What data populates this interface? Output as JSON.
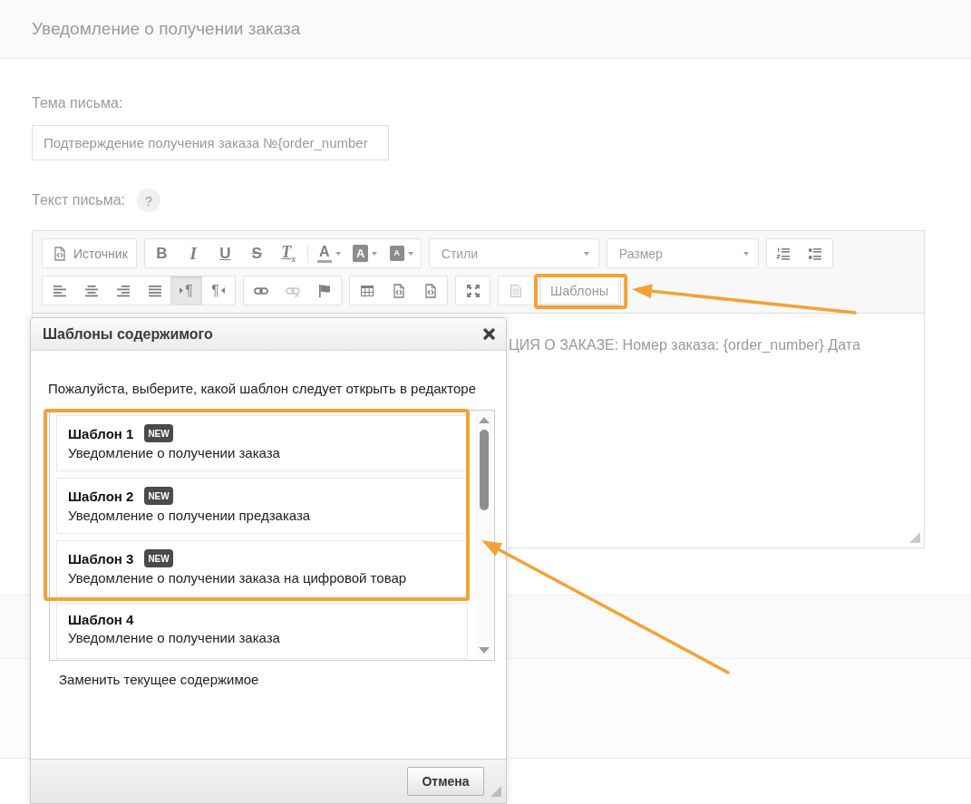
{
  "page": {
    "title": "Уведомление о получении заказа"
  },
  "subject": {
    "label": "Тема письма:",
    "value": "Подтверждение получения заказа №{order_number"
  },
  "body": {
    "label": "Текст письма:",
    "help": "?"
  },
  "editor": {
    "toolbar": [
      [
        {
          "kind": "group",
          "items": [
            {
              "kind": "source",
              "label": "Источник",
              "on": false,
              "disabled": false
            }
          ]
        },
        {
          "kind": "group",
          "items": [
            {
              "kind": "bold",
              "glyph": "B",
              "on": false,
              "disabled": false
            },
            {
              "kind": "italic",
              "glyph": "I",
              "on": false,
              "disabled": false
            },
            {
              "kind": "underline",
              "glyph": "U",
              "on": false,
              "disabled": false
            },
            {
              "kind": "strike",
              "glyph": "S",
              "on": false,
              "disabled": false
            },
            {
              "kind": "clear-format",
              "glyph": "T$_{x}$",
              "on": false,
              "disabled": false
            },
            {
              "kind": "separator"
            },
            {
              "kind": "text-color",
              "glyph": "A",
              "on": false,
              "disabled": false
            },
            {
              "kind": "bg-color",
              "glyph": "A",
              "on": false,
              "disabled": false
            },
            {
              "kind": "bg-color-small",
              "glyph": "A",
              "on": false,
              "disabled": false
            }
          ]
        },
        {
          "kind": "combo",
          "label": "Стили"
        },
        {
          "kind": "combo",
          "label": "Размер"
        },
        {
          "kind": "group",
          "items": [
            {
              "kind": "numbered-list",
              "on": false,
              "disabled": false
            },
            {
              "kind": "bulleted-list",
              "on": false,
              "disabled": false
            }
          ]
        }
      ],
      [
        {
          "kind": "group",
          "items": [
            {
              "kind": "align-left",
              "on": false,
              "disabled": false
            },
            {
              "kind": "align-center",
              "on": false,
              "disabled": false
            },
            {
              "kind": "align-right",
              "on": false,
              "disabled": false
            },
            {
              "kind": "justify",
              "on": false,
              "disabled": false
            },
            {
              "kind": "ltr",
              "glyph": "¶",
              "on": true,
              "disabled": false
            },
            {
              "kind": "rtl",
              "glyph": "¶",
              "on": false,
              "disabled": false
            }
          ]
        },
        {
          "kind": "group",
          "items": [
            {
              "kind": "link",
              "on": false,
              "disabled": false
            },
            {
              "kind": "unlink",
              "on": false,
              "disabled": true
            },
            {
              "kind": "anchor",
              "on": false,
              "disabled": false
            }
          ]
        },
        {
          "kind": "group",
          "items": [
            {
              "kind": "table",
              "on": false,
              "disabled": false
            },
            {
              "kind": "code-block",
              "on": false,
              "disabled": false
            },
            {
              "kind": "code-block",
              "on": false,
              "disabled": false
            }
          ]
        },
        {
          "kind": "group",
          "items": [
            {
              "kind": "maximize",
              "on": false,
              "disabled": false
            }
          ]
        },
        {
          "kind": "group",
          "items": [
            {
              "kind": "preview",
              "on": false,
              "disabled": false
            },
            {
              "kind": "templates",
              "label": "Шаблоны",
              "on": false,
              "disabled": false
            }
          ]
        }
      ]
    ],
    "content": "ЦИЯ О ЗАКАЗЕ: Номер заказа: {order_number} Дата"
  },
  "dialog": {
    "title": "Шаблоны содержимого",
    "prompt": "Пожалуйста, выберите, какой шаблон следует открыть в редакторе",
    "templates": [
      {
        "title": "Шаблон 1",
        "badge": "NEW",
        "description": "Уведомление о получении заказа"
      },
      {
        "title": "Шаблон 2",
        "badge": "NEW",
        "description": "Уведомление о получении предзаказа"
      },
      {
        "title": "Шаблон 3",
        "badge": "NEW",
        "description": "Уведомление о получении заказа на цифровой товар"
      },
      {
        "title": "Шаблон 4",
        "description": "Уведомление о получении заказа"
      }
    ],
    "replace_label": "Заменить текущее содержимое",
    "cancel": "Отмена"
  },
  "annotations": [
    {
      "kind": "frame"
    },
    {
      "kind": "arrow"
    },
    {
      "kind": "frame"
    },
    {
      "kind": "arrow"
    }
  ]
}
